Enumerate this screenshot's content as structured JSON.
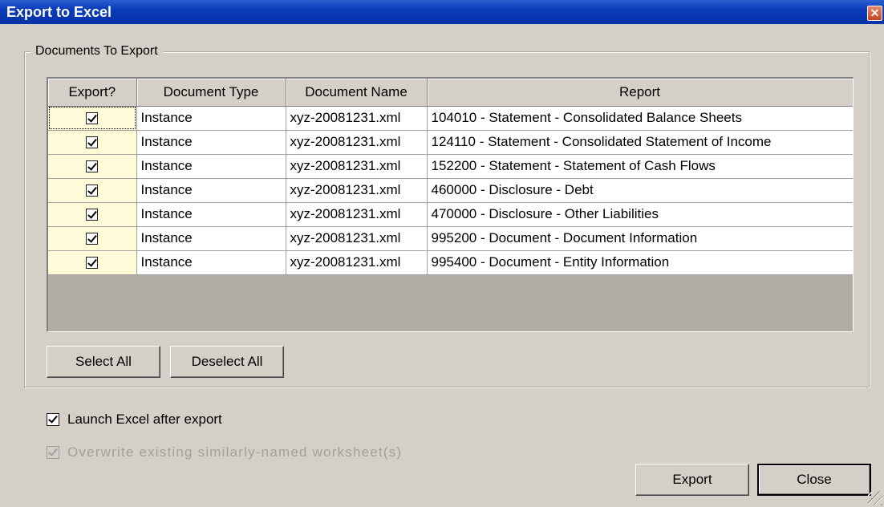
{
  "window": {
    "title": "Export to Excel",
    "close_glyph": "✕"
  },
  "group": {
    "legend": "Documents To Export"
  },
  "table": {
    "columns": [
      "Export?",
      "Document Type",
      "Document Name",
      "Report"
    ],
    "rows": [
      {
        "checked": true,
        "type": "Instance",
        "name": "xyz-20081231.xml",
        "report": "104010 - Statement - Consolidated Balance Sheets"
      },
      {
        "checked": true,
        "type": "Instance",
        "name": "xyz-20081231.xml",
        "report": "124110 - Statement - Consolidated Statement of Income"
      },
      {
        "checked": true,
        "type": "Instance",
        "name": "xyz-20081231.xml",
        "report": "152200 - Statement - Statement of Cash Flows"
      },
      {
        "checked": true,
        "type": "Instance",
        "name": "xyz-20081231.xml",
        "report": "460000 - Disclosure - Debt"
      },
      {
        "checked": true,
        "type": "Instance",
        "name": "xyz-20081231.xml",
        "report": "470000 - Disclosure - Other Liabilities"
      },
      {
        "checked": true,
        "type": "Instance",
        "name": "xyz-20081231.xml",
        "report": "995200 - Document - Document Information"
      },
      {
        "checked": true,
        "type": "Instance",
        "name": "xyz-20081231.xml",
        "report": "995400 - Document - Entity Information"
      }
    ]
  },
  "buttons": {
    "select_all": "Select All",
    "deselect_all": "Deselect All",
    "export": "Export",
    "close": "Close"
  },
  "options": {
    "launch_excel": {
      "label": "Launch Excel after export",
      "checked": true,
      "enabled": true
    },
    "overwrite": {
      "label": "Overwrite existing similarly-named worksheet(s)",
      "checked": true,
      "enabled": false
    }
  }
}
